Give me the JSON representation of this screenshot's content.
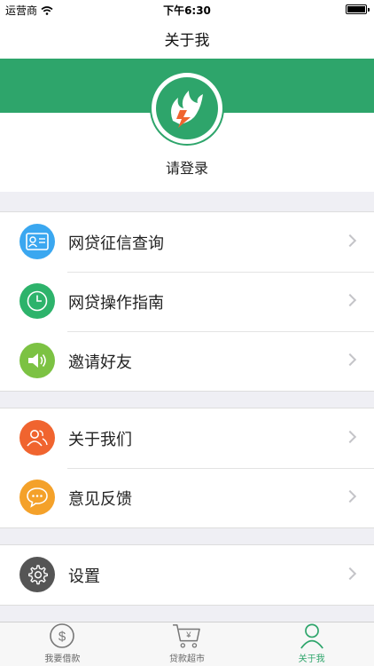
{
  "status_bar": {
    "carrier": "运营商",
    "time": "下午6:30"
  },
  "nav": {
    "title": "关于我"
  },
  "profile": {
    "login_prompt": "请登录"
  },
  "menu": {
    "group1": [
      {
        "label": "网贷征信查询",
        "icon": "id-card-icon",
        "color": "#3aa7f0"
      },
      {
        "label": "网贷操作指南",
        "icon": "clock-icon",
        "color": "#2db36b"
      },
      {
        "label": "邀请好友",
        "icon": "speaker-icon",
        "color": "#7cc243"
      }
    ],
    "group2": [
      {
        "label": "关于我们",
        "icon": "users-icon",
        "color": "#f0642f"
      },
      {
        "label": "意见反馈",
        "icon": "chat-icon",
        "color": "#f4a12a"
      }
    ],
    "group3": [
      {
        "label": "设置",
        "icon": "gear-icon",
        "color": "#555555"
      }
    ]
  },
  "tabs": [
    {
      "label": "我要借款",
      "icon": "dollar-circle-icon",
      "active": false
    },
    {
      "label": "贷款超市",
      "icon": "cart-icon",
      "active": false
    },
    {
      "label": "关于我",
      "icon": "person-icon",
      "active": true
    }
  ],
  "colors": {
    "brand": "#2ea56b",
    "background": "#efeff4"
  }
}
